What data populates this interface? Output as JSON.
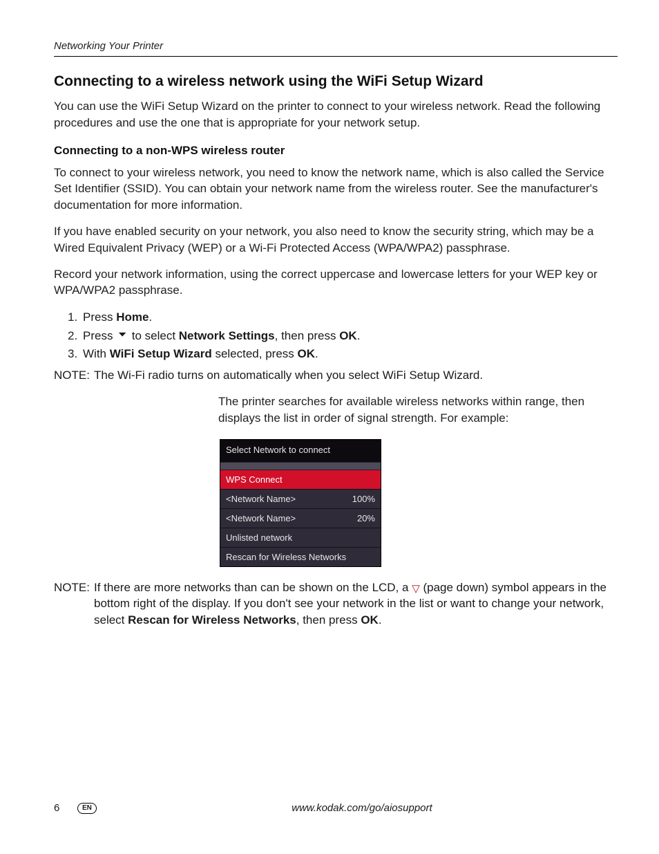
{
  "runningHead": "Networking Your Printer",
  "heading1": "Connecting to a wireless network using the WiFi Setup Wizard",
  "intro": "You can use the WiFi Setup Wizard on the printer to connect to your wireless network. Read the following procedures and use the one that is appropriate for your network setup.",
  "heading2": "Connecting to a non-WPS wireless router",
  "p1": "To connect to your wireless network, you need to know the network name, which is also called the Service Set Identifier (SSID). You can obtain your network name from the wireless router. See the manufacturer's documentation for more information.",
  "p2": "If you have enabled security on your network, you also need to know the security string, which may be a Wired Equivalent Privacy (WEP) or a Wi-Fi Protected Access (WPA/WPA2) passphrase.",
  "p3": "Record your network information, using the correct uppercase and lowercase letters for your WEP key or WPA/WPA2 passphrase.",
  "step1_a": "Press ",
  "step1_b": "Home",
  "step1_c": ".",
  "step2_a": "Press ",
  "step2_b": " to select ",
  "step2_c": "Network Settings",
  "step2_d": ", then press ",
  "step2_e": "OK",
  "step2_f": ".",
  "step3_a": "With ",
  "step3_b": "WiFi Setup Wizard",
  "step3_c": " selected, press ",
  "step3_d": "OK",
  "step3_e": ".",
  "noteLabel": "NOTE:",
  "note1": "The Wi-Fi radio turns on automatically when you select WiFi Setup Wizard.",
  "afterNote": "The printer searches for available wireless networks within range, then displays the list in order of signal strength. For example:",
  "lcd": {
    "title": "Select Network to connect",
    "rows": [
      {
        "left": "WPS Connect",
        "right": "",
        "selected": true
      },
      {
        "left": "<Network Name>",
        "right": "100%",
        "selected": false
      },
      {
        "left": "<Network Name>",
        "right": "20%",
        "selected": false
      },
      {
        "left": "Unlisted network",
        "right": "",
        "selected": false
      },
      {
        "left": "Rescan for Wireless Networks",
        "right": "",
        "selected": false
      }
    ]
  },
  "note2_a": "If there are more networks than can be shown on the LCD, a ",
  "note2_b": " (page down) symbol appears in the bottom right of the display. If you don't see your network in the list or want to change your network, select ",
  "note2_c": "Rescan for Wireless Networks",
  "note2_d": ", then press ",
  "note2_e": "OK",
  "note2_f": ".",
  "footer": {
    "page": "6",
    "lang": "EN",
    "url": "www.kodak.com/go/aiosupport"
  }
}
